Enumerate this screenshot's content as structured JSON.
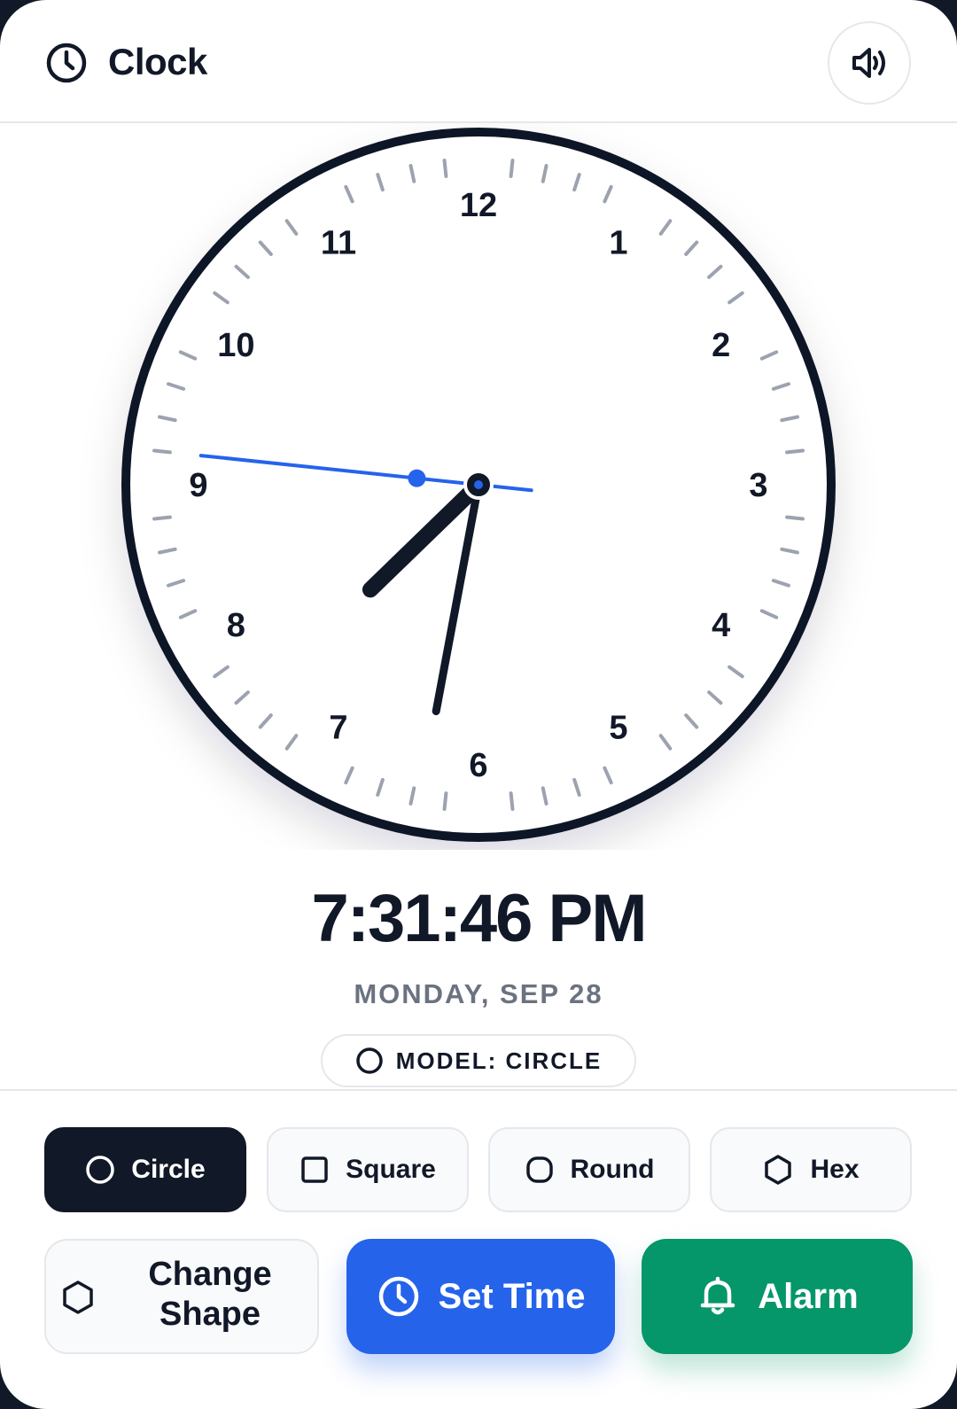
{
  "header": {
    "title": "Clock",
    "title_icon": "clock-icon",
    "sound_icon": "speaker-icon"
  },
  "clock": {
    "shape": "circle",
    "numerals": [
      "12",
      "1",
      "2",
      "3",
      "4",
      "5",
      "6",
      "7",
      "8",
      "9",
      "10",
      "11"
    ],
    "time": {
      "hours": 19,
      "minutes": 31,
      "seconds": 46
    },
    "colors": {
      "face": "#ffffff",
      "rim": "#111827",
      "ticks": "#9ca3af",
      "hands": "#111827",
      "second_hand": "#2563eb"
    }
  },
  "digital": {
    "time": "7:31:46 PM",
    "date": "MONDAY, SEP 28"
  },
  "model_badge": {
    "label": "MODEL: CIRCLE",
    "icon": "circle-icon"
  },
  "shape_options": [
    {
      "label": "Circle",
      "icon": "circle-icon",
      "selected": true
    },
    {
      "label": "Square",
      "icon": "square-icon",
      "selected": false
    },
    {
      "label": "Round",
      "icon": "rounded-square-icon",
      "selected": false
    },
    {
      "label": "Hex",
      "icon": "hexagon-icon",
      "selected": false
    }
  ],
  "actions": {
    "change_shape": {
      "line1": "Change",
      "line2": "Shape",
      "icon": "hexagon-icon"
    },
    "set_time": {
      "label": "Set Time",
      "icon": "clock-icon",
      "color": "#2563eb"
    },
    "alarm": {
      "label": "Alarm",
      "icon": "bell-icon",
      "color": "#059669"
    }
  },
  "colors": {
    "selected_background": "#111827",
    "border": "#e5e7eb",
    "muted_text": "#6b7280"
  }
}
